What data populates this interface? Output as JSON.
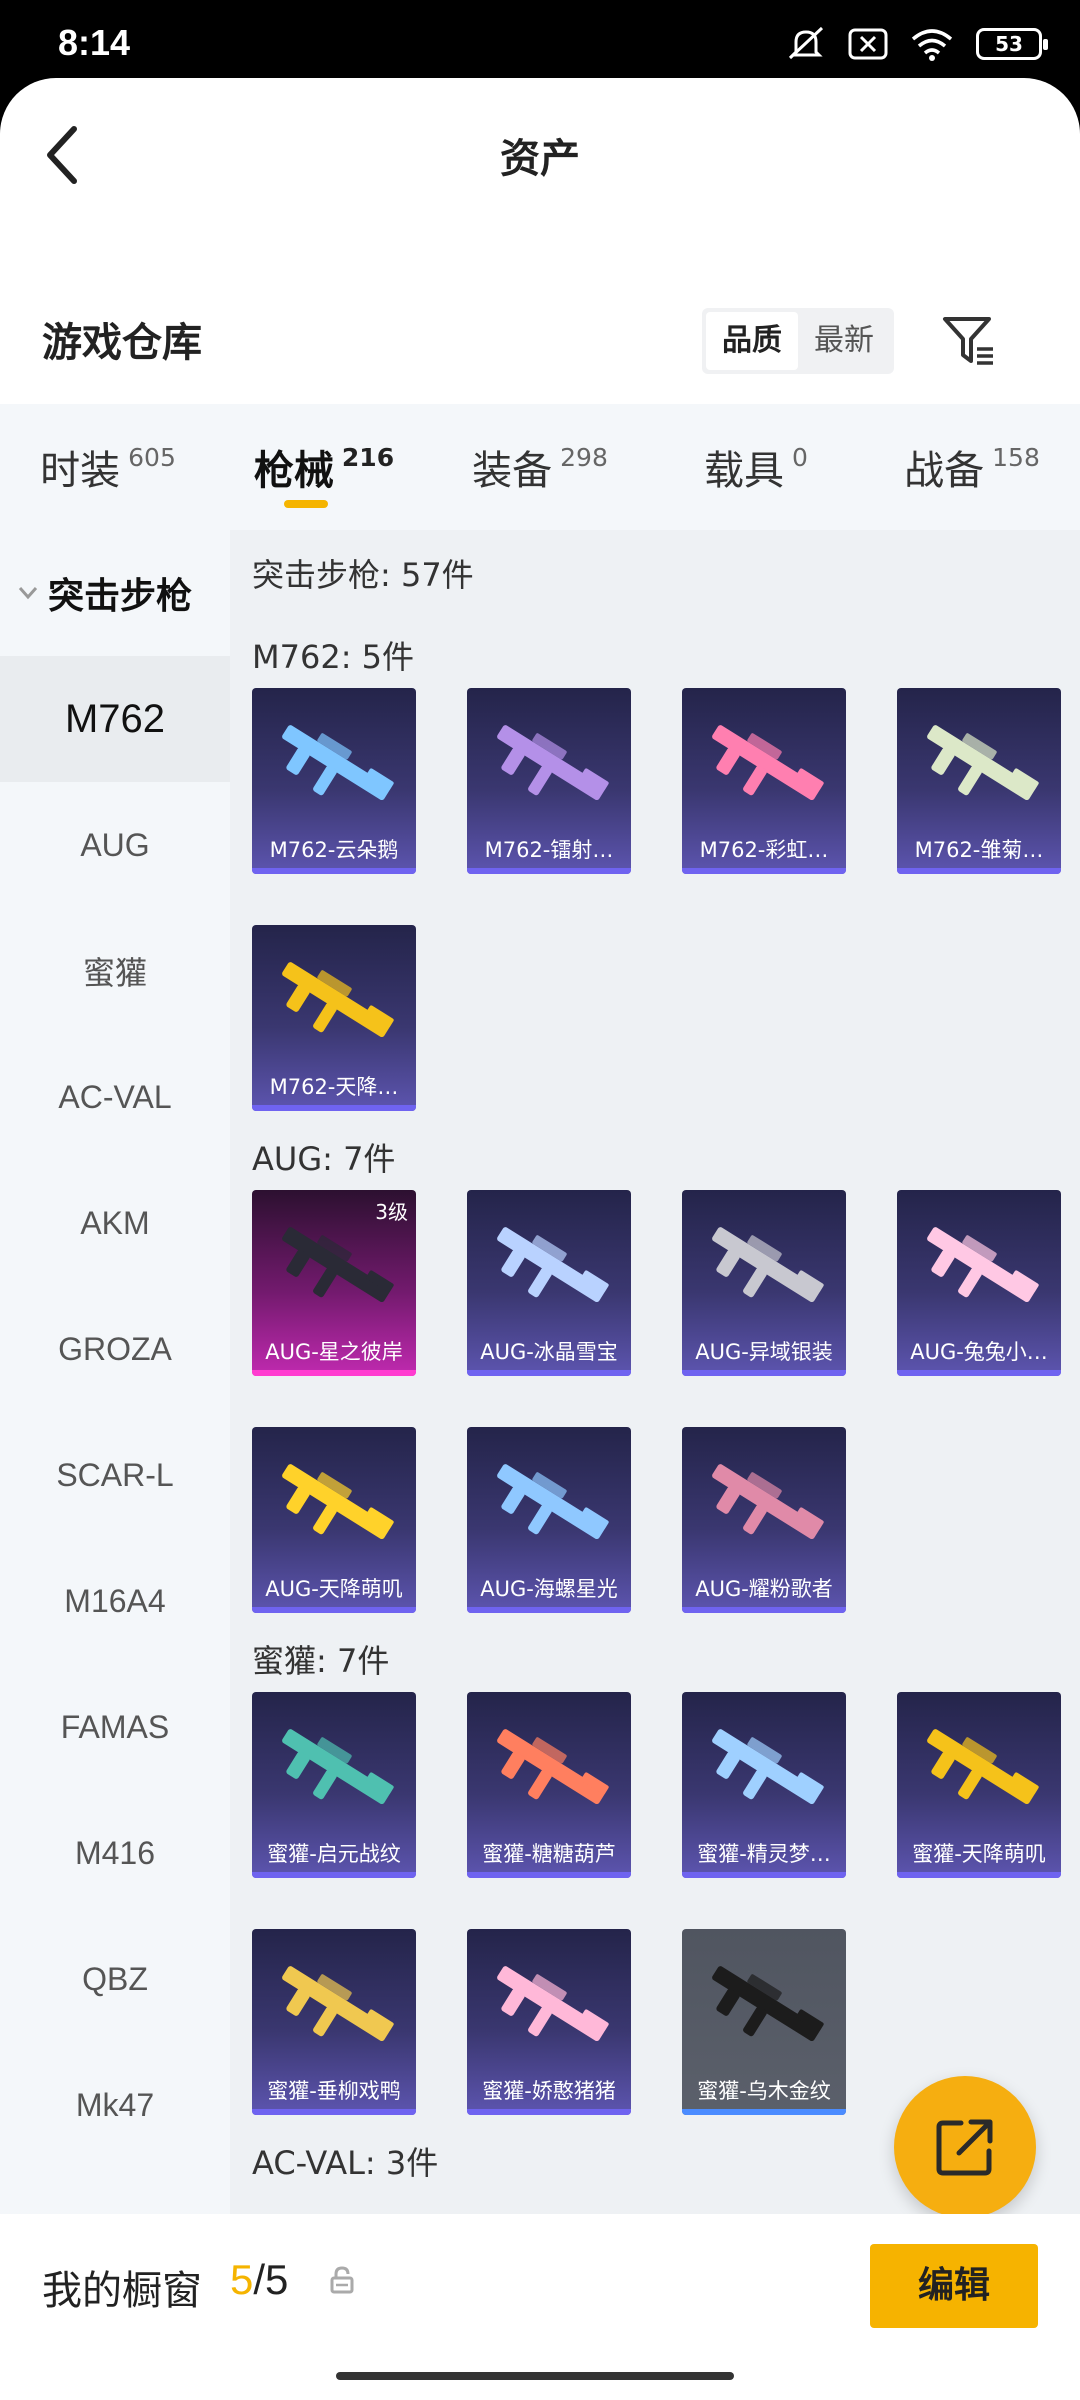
{
  "status_bar": {
    "time": "8:14",
    "battery": "53"
  },
  "header": {
    "title": "资产"
  },
  "warehouse": {
    "title": "游戏仓库",
    "sort": {
      "options": [
        "品质",
        "最新"
      ],
      "selected": "品质"
    }
  },
  "categories": [
    {
      "name": "时装",
      "count": "605",
      "active": false
    },
    {
      "name": "枪械",
      "count": "216",
      "active": true
    },
    {
      "name": "装备",
      "count": "298",
      "active": false
    },
    {
      "name": "载具",
      "count": "0",
      "active": false
    },
    {
      "name": "战备",
      "count": "158",
      "active": false
    }
  ],
  "sidebar": {
    "group": "突击步枪",
    "items": [
      "M762",
      "AUG",
      "蜜獾",
      "AC-VAL",
      "AKM",
      "GROZA",
      "SCAR-L",
      "M16A4",
      "FAMAS",
      "M416",
      "QBZ",
      "Mk47"
    ],
    "active": "M762"
  },
  "content": {
    "total_line": "突击步枪: 57件",
    "groups": [
      {
        "header": "M762: 5件",
        "items": [
          {
            "name": "M762-云朵鹅",
            "color": "#7fc6ff",
            "style": "normal"
          },
          {
            "name": "M762-镭射…",
            "color": "#b490e8",
            "style": "normal"
          },
          {
            "name": "M762-彩虹…",
            "color": "#ff7fb0",
            "style": "normal"
          },
          {
            "name": "M762-雏菊…",
            "color": "#dce8c8",
            "style": "normal"
          },
          {
            "name": "M762-天降…",
            "color": "#f5c21a",
            "style": "normal"
          }
        ]
      },
      {
        "header": "AUG: 7件",
        "items": [
          {
            "name": "AUG-星之彼岸",
            "color": "#2a2a36",
            "style": "pink",
            "level": "3级"
          },
          {
            "name": "AUG-冰晶雪宝",
            "color": "#b9d2ff",
            "style": "normal"
          },
          {
            "name": "AUG-异域银装",
            "color": "#c8c8d0",
            "style": "normal"
          },
          {
            "name": "AUG-兔兔小…",
            "color": "#ffc8e4",
            "style": "normal"
          },
          {
            "name": "AUG-天降萌叽",
            "color": "#ffd22a",
            "style": "normal"
          },
          {
            "name": "AUG-海螺星光",
            "color": "#8fc8ff",
            "style": "normal"
          },
          {
            "name": "AUG-耀粉歌者",
            "color": "#e08aa8",
            "style": "normal"
          }
        ]
      },
      {
        "header": "蜜獾: 7件",
        "items": [
          {
            "name": "蜜獾-启元战纹",
            "color": "#4fc0b0",
            "style": "normal"
          },
          {
            "name": "蜜獾-糖糖葫芦",
            "color": "#ff7f5f",
            "style": "normal"
          },
          {
            "name": "蜜獾-精灵梦…",
            "color": "#9fd0ff",
            "style": "normal"
          },
          {
            "name": "蜜獾-天降萌叽",
            "color": "#f5c21a",
            "style": "normal"
          },
          {
            "name": "蜜獾-垂柳戏鸭",
            "color": "#f0c850",
            "style": "normal"
          },
          {
            "name": "蜜獾-娇憨猪猪",
            "color": "#ffb8d8",
            "style": "normal"
          },
          {
            "name": "蜜獾-乌木金纹",
            "color": "#1c1c1c",
            "style": "gray"
          }
        ]
      },
      {
        "header": "AC-VAL: 3件",
        "items": []
      }
    ]
  },
  "showcase": {
    "label": "我的橱窗",
    "current": "5",
    "separator": "/",
    "total": "5",
    "edit_label": "编辑"
  }
}
